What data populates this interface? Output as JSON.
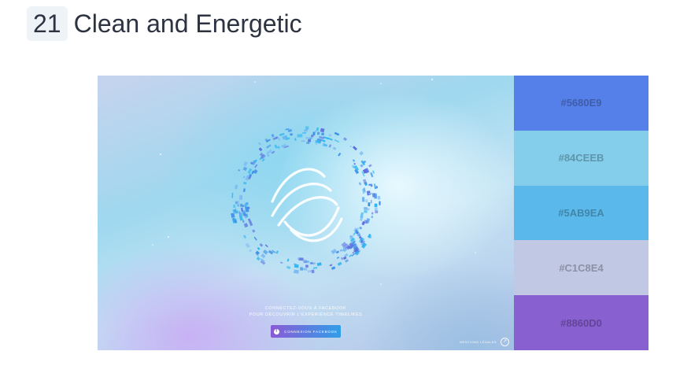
{
  "heading": {
    "number": "21",
    "title": "Clean and Energetic"
  },
  "preview": {
    "line1": "CONNECTEZ-VOUS À FACEBOOK",
    "line2": "POUR DÉCOUVRIR L'EXPÉRIENCE TIMELIKES",
    "button_label": "CONNEXION FACEBOOK",
    "button_icon": "f",
    "corner_label": "MENTIONS LÉGALES",
    "colors": {
      "ring_primary": "#3e8fe8",
      "ring_secondary": "#2bb3ee",
      "ring_tertiary": "#5a6ee0"
    }
  },
  "palette": {
    "swatches": [
      {
        "label": "#5680E9",
        "color": "#5680E9"
      },
      {
        "label": "#84CEEB",
        "color": "#84CEEB"
      },
      {
        "label": "#5AB9EA",
        "color": "#5AB9EA"
      },
      {
        "label": "#C1C8E4",
        "color": "#C1C8E4"
      },
      {
        "label": "#8860D0",
        "color": "#8860D0"
      }
    ]
  }
}
